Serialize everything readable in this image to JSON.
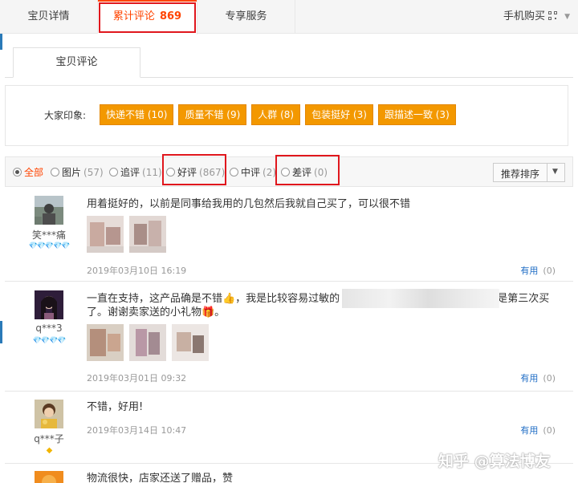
{
  "tabs": {
    "detail": "宝贝详情",
    "reviews": "累计评论",
    "reviews_count": "869",
    "service": "专享服务",
    "mobile_buy": "手机购买"
  },
  "sub_tab": "宝贝评论",
  "impressions": {
    "label": "大家印象:",
    "tags": [
      "快递不错 (10)",
      "质量不错 (9)",
      "人群 (8)",
      "包装挺好 (3)",
      "跟描述一致 (3)"
    ]
  },
  "filters": {
    "all": "全部",
    "pics": "图片",
    "pics_count": "(57)",
    "followup": "追评",
    "followup_count": "(11)",
    "good": "好评",
    "good_count": "(867)",
    "mid": "中评",
    "mid_count": "(2)",
    "bad": "差评",
    "bad_count": "(0)",
    "sort": "推荐排序"
  },
  "reviews": [
    {
      "user": "笑***痛",
      "level": "💎💎💎💎💎",
      "text": "用着挺好的，以前是同事给我用的几包然后我就自己买了，可以很不错",
      "date": "2019年03月10日 16:19",
      "useful": "有用",
      "useful_count": "(0)"
    },
    {
      "user": "q***3",
      "level": "💎💎💎💎",
      "text_line1a": "一直在支持，这产品确是不错👍，我是比较容易过敏的",
      "text_line1b": "是第三次买",
      "text_line2": "了。谢谢卖家送的小礼物🎁。",
      "date": "2019年03月01日 09:32",
      "useful": "有用",
      "useful_count": "(0)"
    },
    {
      "user": "q***子",
      "level": "◆",
      "text": "不错，好用!",
      "date": "2019年03月14日 10:47",
      "useful": "有用",
      "useful_count": "(0)"
    },
    {
      "text": "物流很快，店家还送了赠品，赞"
    }
  ],
  "watermark": "知乎 @算法博友",
  "colors": {
    "accent": "#ff4400",
    "tag_bg": "#f39800",
    "highlight_box": "#e0171d",
    "link": "#1f6dc5"
  }
}
